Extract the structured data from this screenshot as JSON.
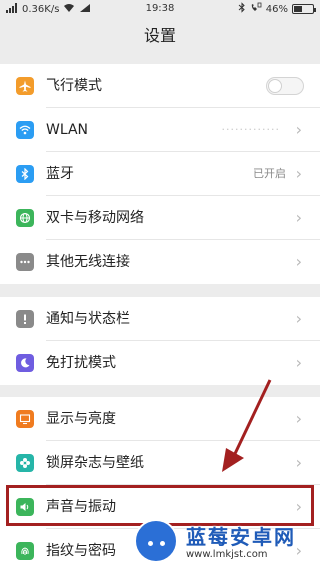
{
  "status_bar": {
    "network_speed": "0.36K/s",
    "time": "19:38",
    "battery": "46%",
    "battery_level": 0.46
  },
  "header": {
    "title": "设置"
  },
  "groups": [
    {
      "items": [
        {
          "label": "飞行模式",
          "icon": "airplane-icon",
          "icon_color": "#f39c2b",
          "control": "toggle",
          "toggle_on": false
        },
        {
          "label": "WLAN",
          "icon": "wifi-icon",
          "icon_color": "#2b9df3",
          "value": "·············"
        },
        {
          "label": "蓝牙",
          "icon": "bluetooth-icon",
          "icon_color": "#2b9df3",
          "status": "已开启"
        },
        {
          "label": "双卡与移动网络",
          "icon": "globe-icon",
          "icon_color": "#3cb55b"
        },
        {
          "label": "其他无线连接",
          "icon": "more-dots-icon",
          "icon_color": "#8a8a8a"
        }
      ]
    },
    {
      "items": [
        {
          "label": "通知与状态栏",
          "icon": "notification-icon",
          "icon_color": "#8a8a8a"
        },
        {
          "label": "免打扰模式",
          "icon": "moon-icon",
          "icon_color": "#6f5de0"
        }
      ]
    },
    {
      "items": [
        {
          "label": "显示与亮度",
          "icon": "display-icon",
          "icon_color": "#f07b1f"
        },
        {
          "label": "锁屏杂志与壁纸",
          "icon": "flower-icon",
          "icon_color": "#26b5a8"
        },
        {
          "label": "声音与振动",
          "icon": "speaker-icon",
          "icon_color": "#3cb55b"
        },
        {
          "label": "指纹与密码",
          "icon": "fingerprint-icon",
          "icon_color": "#3cb55b"
        }
      ]
    }
  ],
  "watermark": {
    "title": "蓝莓安卓网",
    "url": "www.lmkjst.com"
  },
  "colors": {
    "annotation_red": "#a32020",
    "background": "#ececec"
  }
}
